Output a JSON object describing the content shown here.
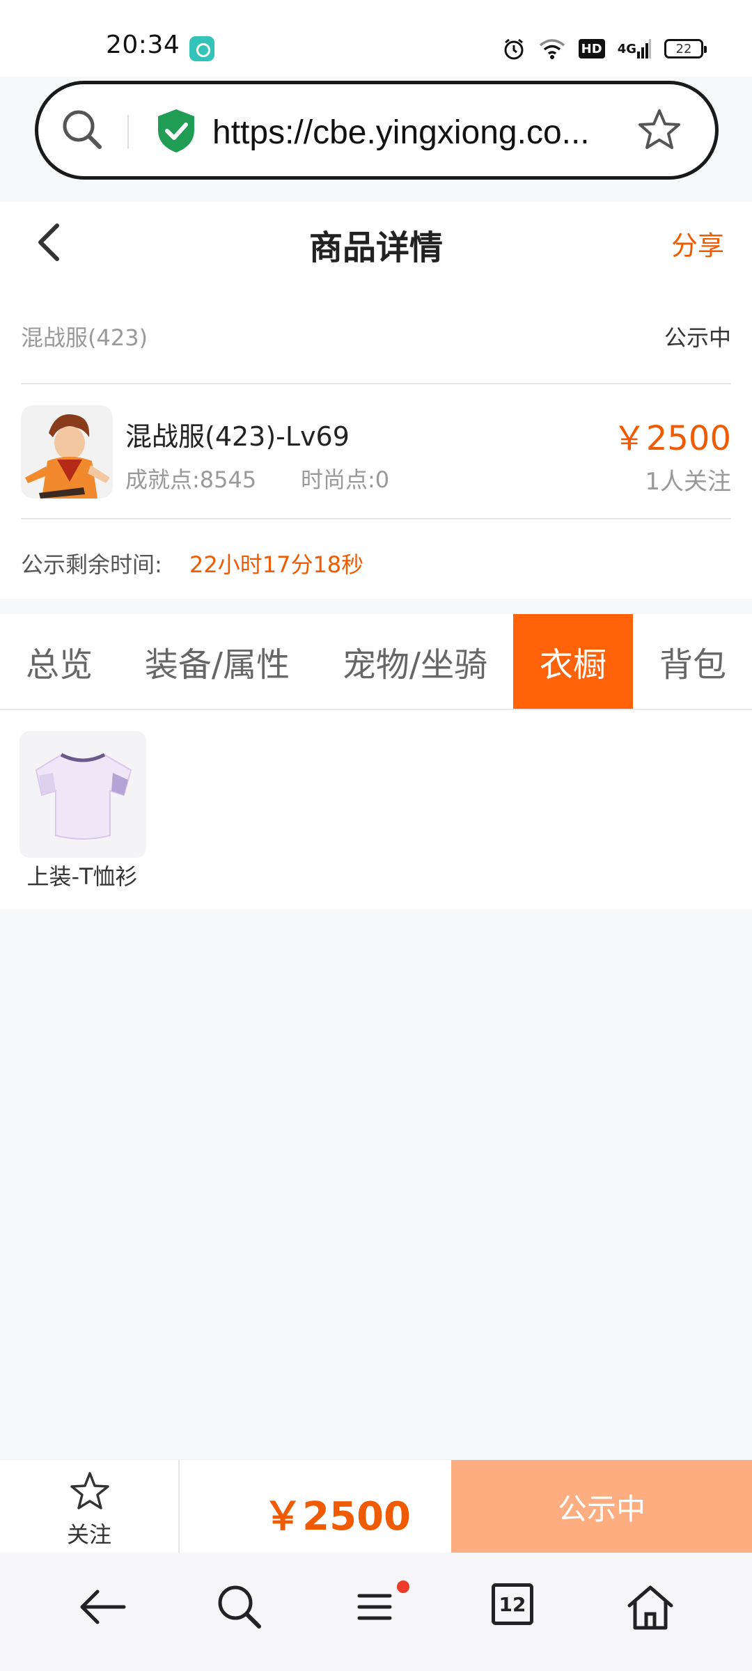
{
  "status_bar": {
    "time": "20:34",
    "icons": [
      "alarm-icon",
      "wifi-icon",
      "hd-icon",
      "4g-signal-icon",
      "battery-icon"
    ],
    "hd_label": "HD",
    "network_label": "4G",
    "battery_level": "22"
  },
  "browser": {
    "url": "https://cbe.yingxiong.co..."
  },
  "header": {
    "title": "商品详情",
    "share_label": "分享"
  },
  "product": {
    "server_name": "混战服(423)",
    "server_status": "公示中",
    "character_name": "混战服(423)-Lv69",
    "achievement_points": "成就点:8545",
    "fashion_points": "时尚点:0",
    "price": "￥2500",
    "followers": "1人关注",
    "remaining_label": "公示剩余时间:",
    "remaining_time": "22小时17分18秒"
  },
  "tabs": [
    {
      "label": "总览",
      "active": false
    },
    {
      "label": "装备/属性",
      "active": false
    },
    {
      "label": "宠物/坐骑",
      "active": false
    },
    {
      "label": "衣橱",
      "active": true
    },
    {
      "label": "背包",
      "active": false
    }
  ],
  "wardrobe": {
    "items": [
      {
        "label": "上装-T恤衫"
      }
    ]
  },
  "action_bar": {
    "follow_label": "关注",
    "price": "￥2500",
    "status_button_label": "公示中"
  },
  "bottom_nav": {
    "tabs_count": "12"
  },
  "colors": {
    "accent": "#ff6208",
    "accent_text": "#f05a00",
    "status_button": "#fdad7f"
  }
}
